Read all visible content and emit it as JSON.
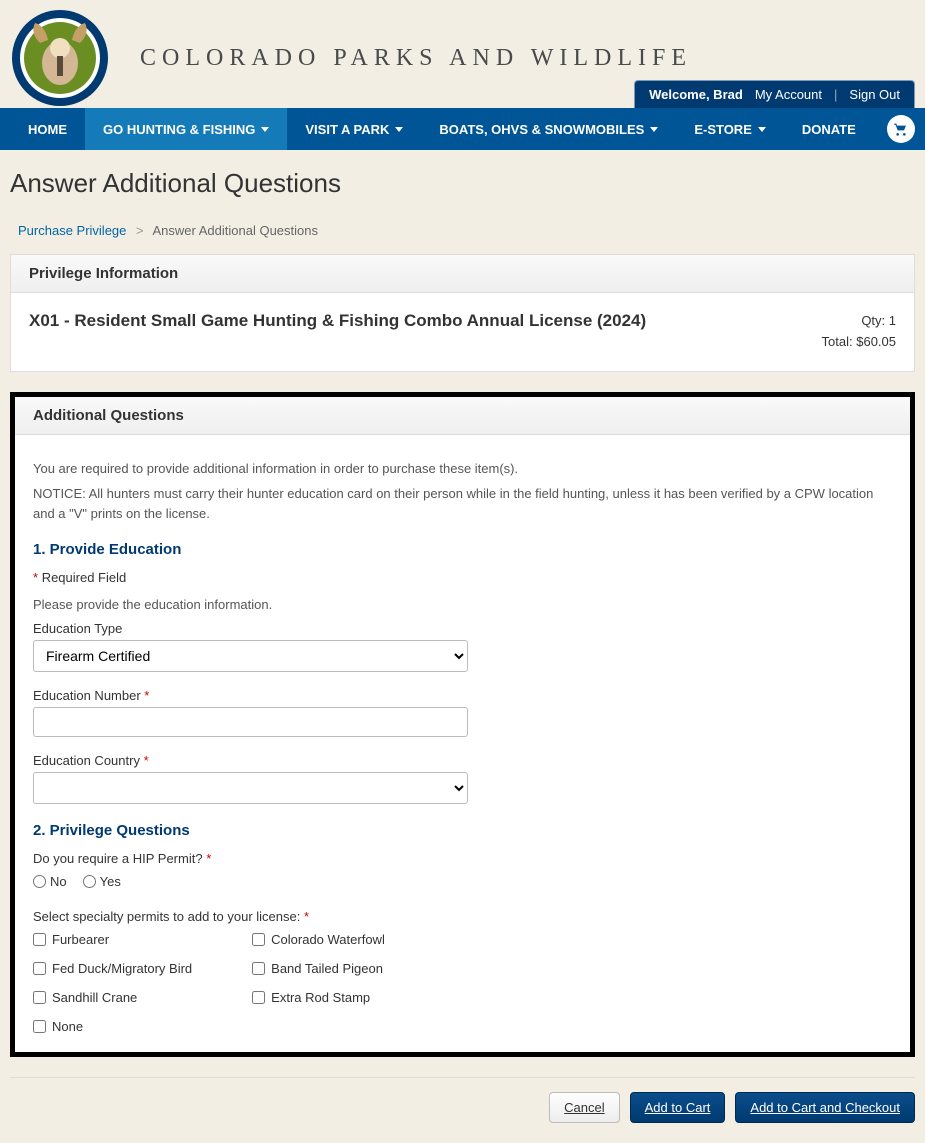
{
  "header": {
    "site_title": "COLORADO PARKS AND WILDLIFE",
    "welcome": "Welcome, Brad",
    "my_account": "My Account",
    "sign_out": "Sign Out"
  },
  "nav": {
    "items": [
      {
        "label": "HOME",
        "dropdown": false,
        "active": false
      },
      {
        "label": "GO HUNTING & FISHING",
        "dropdown": true,
        "active": true
      },
      {
        "label": "VISIT A PARK",
        "dropdown": true,
        "active": false
      },
      {
        "label": "BOATS, OHVS & SNOWMOBILES",
        "dropdown": true,
        "active": false
      },
      {
        "label": "E-STORE",
        "dropdown": true,
        "active": false
      },
      {
        "label": "DONATE",
        "dropdown": false,
        "active": false
      }
    ]
  },
  "page_title": "Answer Additional Questions",
  "breadcrumb": {
    "link": "Purchase Privilege",
    "current": "Answer Additional Questions"
  },
  "privilege_panel": {
    "header": "Privilege Information",
    "title": "X01 - Resident Small Game Hunting & Fishing Combo Annual License (2024)",
    "qty_label": "Qty: 1",
    "total_label": "Total: $60.05"
  },
  "questions_panel": {
    "header": "Additional Questions",
    "intro": "You are required to provide additional information in order to purchase these item(s).",
    "notice": "NOTICE: All hunters must carry their hunter education card on their person while in the field hunting, unless it has been verified by a CPW location and a \"V\" prints on the license.",
    "section1_title": "1. Provide Education",
    "required_field": "Required Field",
    "edu_intro": "Please provide the education information.",
    "edu_type_label": "Education Type",
    "edu_type_value": "Firearm Certified",
    "edu_number_label": "Education Number",
    "edu_number_value": "",
    "edu_country_label": "Education Country",
    "edu_country_value": "",
    "section2_title": "2. Privilege Questions",
    "hip_question": "Do you require a HIP Permit?",
    "hip_no": "No",
    "hip_yes": "Yes",
    "specialty_question": "Select specialty permits to add to your license:",
    "permits_col1": [
      "Furbearer",
      "Fed Duck/Migratory Bird",
      "Sandhill Crane",
      "None"
    ],
    "permits_col2": [
      "Colorado Waterfowl",
      "Band Tailed Pigeon",
      "Extra Rod Stamp"
    ]
  },
  "actions": {
    "cancel": "Cancel",
    "add": "Add to Cart",
    "add_checkout": "Add to Cart and Checkout"
  }
}
